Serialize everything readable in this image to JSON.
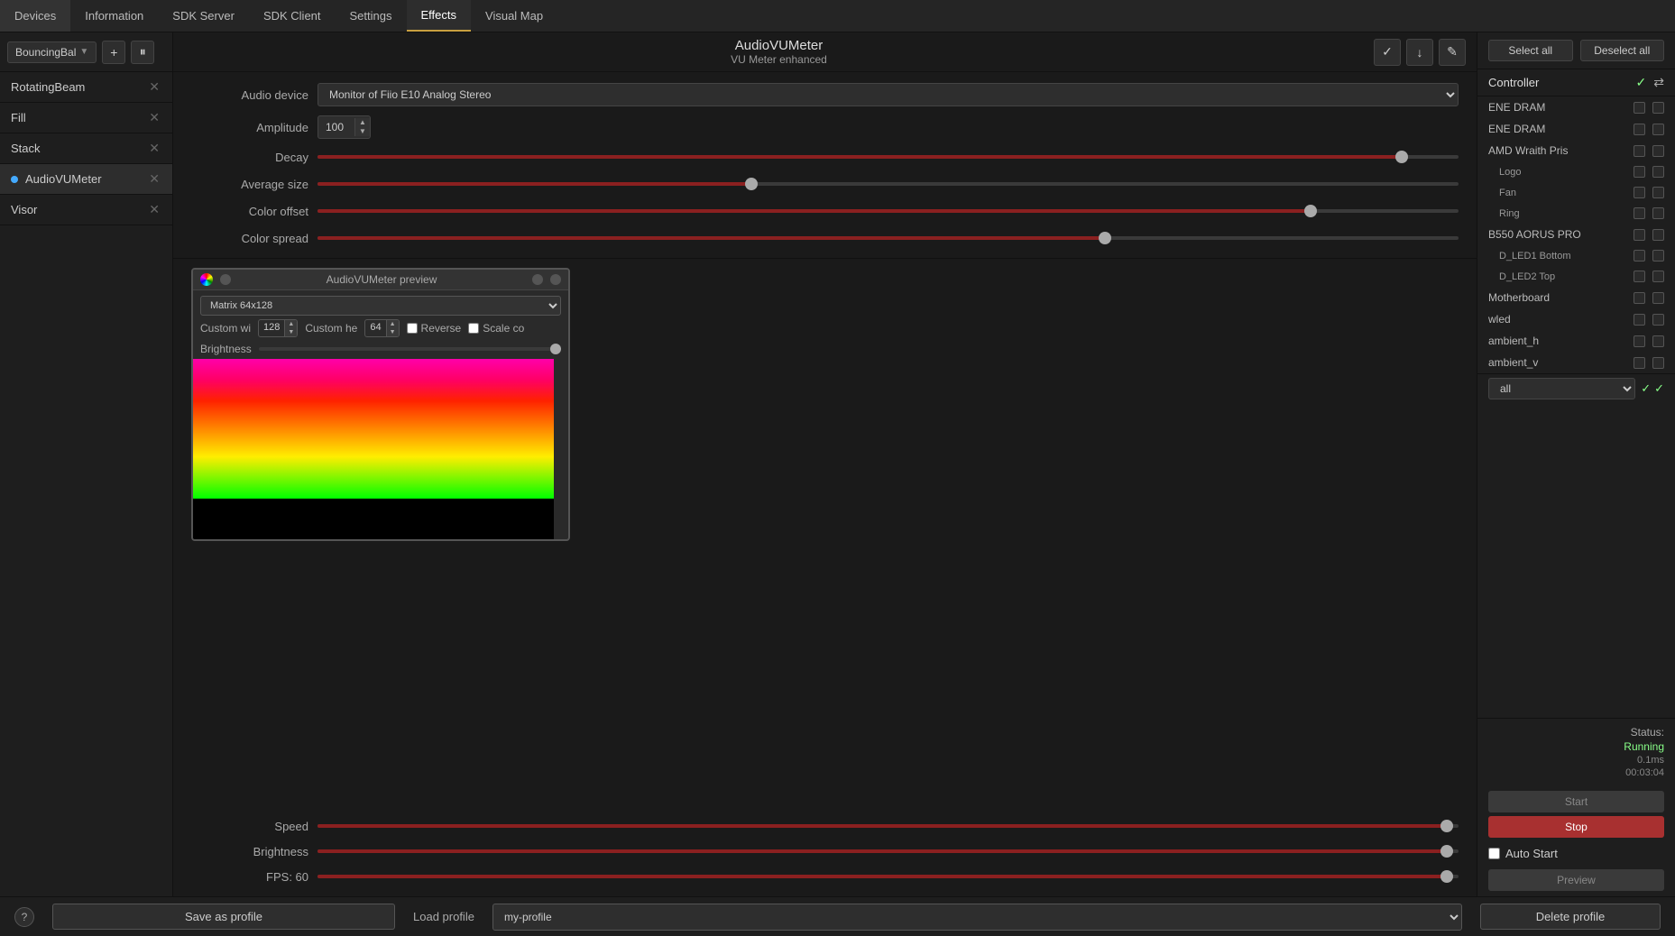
{
  "menubar": {
    "items": [
      {
        "label": "Devices",
        "active": false
      },
      {
        "label": "Information",
        "active": false
      },
      {
        "label": "SDK Server",
        "active": false
      },
      {
        "label": "SDK Client",
        "active": false
      },
      {
        "label": "Settings",
        "active": false
      },
      {
        "label": "Effects",
        "active": true
      },
      {
        "label": "Visual Map",
        "active": false
      }
    ]
  },
  "sidebar": {
    "dropdown_label": "BouncingBal",
    "items": [
      {
        "label": "RotatingBeam",
        "has_close": true,
        "has_dot": false
      },
      {
        "label": "Fill",
        "has_close": true,
        "has_dot": false
      },
      {
        "label": "Stack",
        "has_close": true,
        "has_dot": false
      },
      {
        "label": "AudioVUMeter",
        "has_close": true,
        "has_dot": true
      },
      {
        "label": "Visor",
        "has_close": true,
        "has_dot": false
      }
    ]
  },
  "effect": {
    "title": "AudioVUMeter",
    "subtitle": "VU Meter enhanced"
  },
  "controls": {
    "audio_device_label": "Audio device",
    "audio_device_value": "Monitor of Fiio E10 Analog Stereo",
    "amplitude_label": "Amplitude",
    "amplitude_value": "100",
    "decay_label": "Decay",
    "decay_pct": 95,
    "average_size_label": "Average size",
    "average_size_pct": 38,
    "color_offset_label": "Color offset",
    "color_offset_pct": 87,
    "color_spread_label": "Color spread",
    "color_spread_pct": 69
  },
  "preview": {
    "title": "AudioVUMeter preview",
    "matrix_label": "Matrix 64x128",
    "custom_width_label": "Custom wi",
    "custom_width_value": "128",
    "custom_height_label": "Custom he",
    "custom_height_value": "64",
    "reverse_label": "Reverse",
    "scale_co_label": "Scale co",
    "brightness_label": "Brightness"
  },
  "params": {
    "speed_label": "Speed",
    "speed_pct": 99,
    "brightness_label": "Brightness",
    "brightness_pct": 99,
    "fps_label": "FPS: 60",
    "fps_pct": 99
  },
  "right_panel": {
    "select_all_label": "Select all",
    "deselect_all_label": "Deselect all",
    "controller_label": "Controller",
    "devices": [
      {
        "name": "ENE DRAM",
        "indented": false,
        "group": "ene1"
      },
      {
        "name": "ENE DRAM",
        "indented": false,
        "group": "ene2"
      },
      {
        "name": "AMD Wraith Pris",
        "indented": false,
        "group": "amd"
      },
      {
        "name": "Logo",
        "indented": true,
        "group": "amd_logo"
      },
      {
        "name": "Fan",
        "indented": true,
        "group": "amd_fan"
      },
      {
        "name": "Ring",
        "indented": true,
        "group": "amd_ring"
      },
      {
        "name": "B550 AORUS PRO",
        "indented": false,
        "group": "b550"
      },
      {
        "name": "D_LED1 Bottom",
        "indented": true,
        "group": "dled1"
      },
      {
        "name": "D_LED2 Top",
        "indented": true,
        "group": "dled2"
      },
      {
        "name": "Motherboard",
        "indented": false,
        "group": "mb"
      },
      {
        "name": "wled",
        "indented": false,
        "group": "wled"
      },
      {
        "name": "ambient_h",
        "indented": false,
        "group": "ambient_h"
      },
      {
        "name": "ambient_v",
        "indented": false,
        "group": "ambient_v"
      }
    ],
    "status_label": "Status:",
    "status_running": "Running",
    "status_time": "0.1ms",
    "status_duration": "00:03:04",
    "all_dropdown": "all",
    "start_label": "Start",
    "stop_label": "Stop",
    "auto_start_label": "Auto Start",
    "preview_label": "Preview"
  },
  "bottom_bar": {
    "help_label": "?",
    "save_label": "Save as profile",
    "load_label": "Load profile",
    "load_value": "my-profile",
    "delete_label": "Delete profile"
  }
}
